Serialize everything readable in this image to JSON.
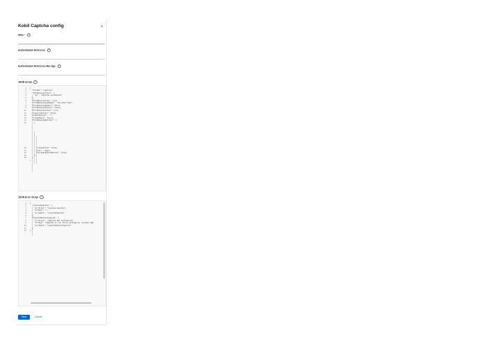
{
  "dialog": {
    "title": "Kobil Captcha config",
    "close_icon": "close-icon"
  },
  "fields": {
    "alias": {
      "label": "Alias",
      "required_marker": "*",
      "value": ""
    },
    "auth_reference": {
      "label": "Authenticator Reference",
      "value": ""
    },
    "auth_reference_max_age": {
      "label": "Authenticator Reference Max Age",
      "value": ""
    }
  },
  "json_script": {
    "label": "JSON Script",
    "line_numbers": [
      "1",
      "2",
      "3",
      "4",
      "5",
      "6",
      "7",
      "8",
      "9",
      "10",
      "11",
      "12",
      "13",
      "14",
      "15",
      "16",
      "17",
      "18",
      "19",
      "20"
    ],
    "lines": [
      "{",
      "  \"formId\": \"captcha\",",
      "  \"formDisplayTitle\": {",
      "    \"en\": \"Captcha validation\"",
      "  },",
      "  \"formDescription\": null,",
      "  \"formBackgroundImage\": \"db:some_flow\",",
      "  \"formDisplayHeader\": false,",
      "  \"formDisplayCancel\": false,",
      "  \"formDisplayClose\": true,",
      "  \"requireAction\": false,",
      "  \"submitAction\": \"\",",
      "  \"lineIdOver\": false,",
      "  \"formDisplayButtons\": [",
      "    {",
      "      \"isDisabled\": false,",
      "      \"key\": \"Sign\",",
      "      \"includeInFormResult\": false",
      "    }",
      "  ]",
      "}"
    ]
  },
  "json_error_script": {
    "label": "JSON Error Script",
    "line_numbers": [
      "1",
      "2",
      "3",
      "4",
      "5",
      "6",
      "7",
      "8",
      "9",
      "10",
      "11",
      "12",
      "13"
    ],
    "lines": [
      "{",
      "  \"invalidCaptcha\": {",
      "    \"errTitle\": \"Invalid Captcha\",",
      "    \"errMsg\": \"\",",
      "    \"errIdent\": \"invalidCaptcha\"",
      "  },",
      "  \"captchaNotConfigured\": {",
      "    \"errTitle\": \"Captcha Not Configured\",",
      "    \"errMsg\": \"Captcha is not fully configured. Contact Adm",
      "    \"errIdent\": \"captchaNotConfigured\"",
      "  }",
      "}"
    ]
  },
  "actions": {
    "save_label": "Save",
    "cancel_label": "Cancel"
  },
  "colors": {
    "primary": "#0066cc",
    "required": "#c9190b",
    "editor_bg": "#f8f8f8"
  }
}
